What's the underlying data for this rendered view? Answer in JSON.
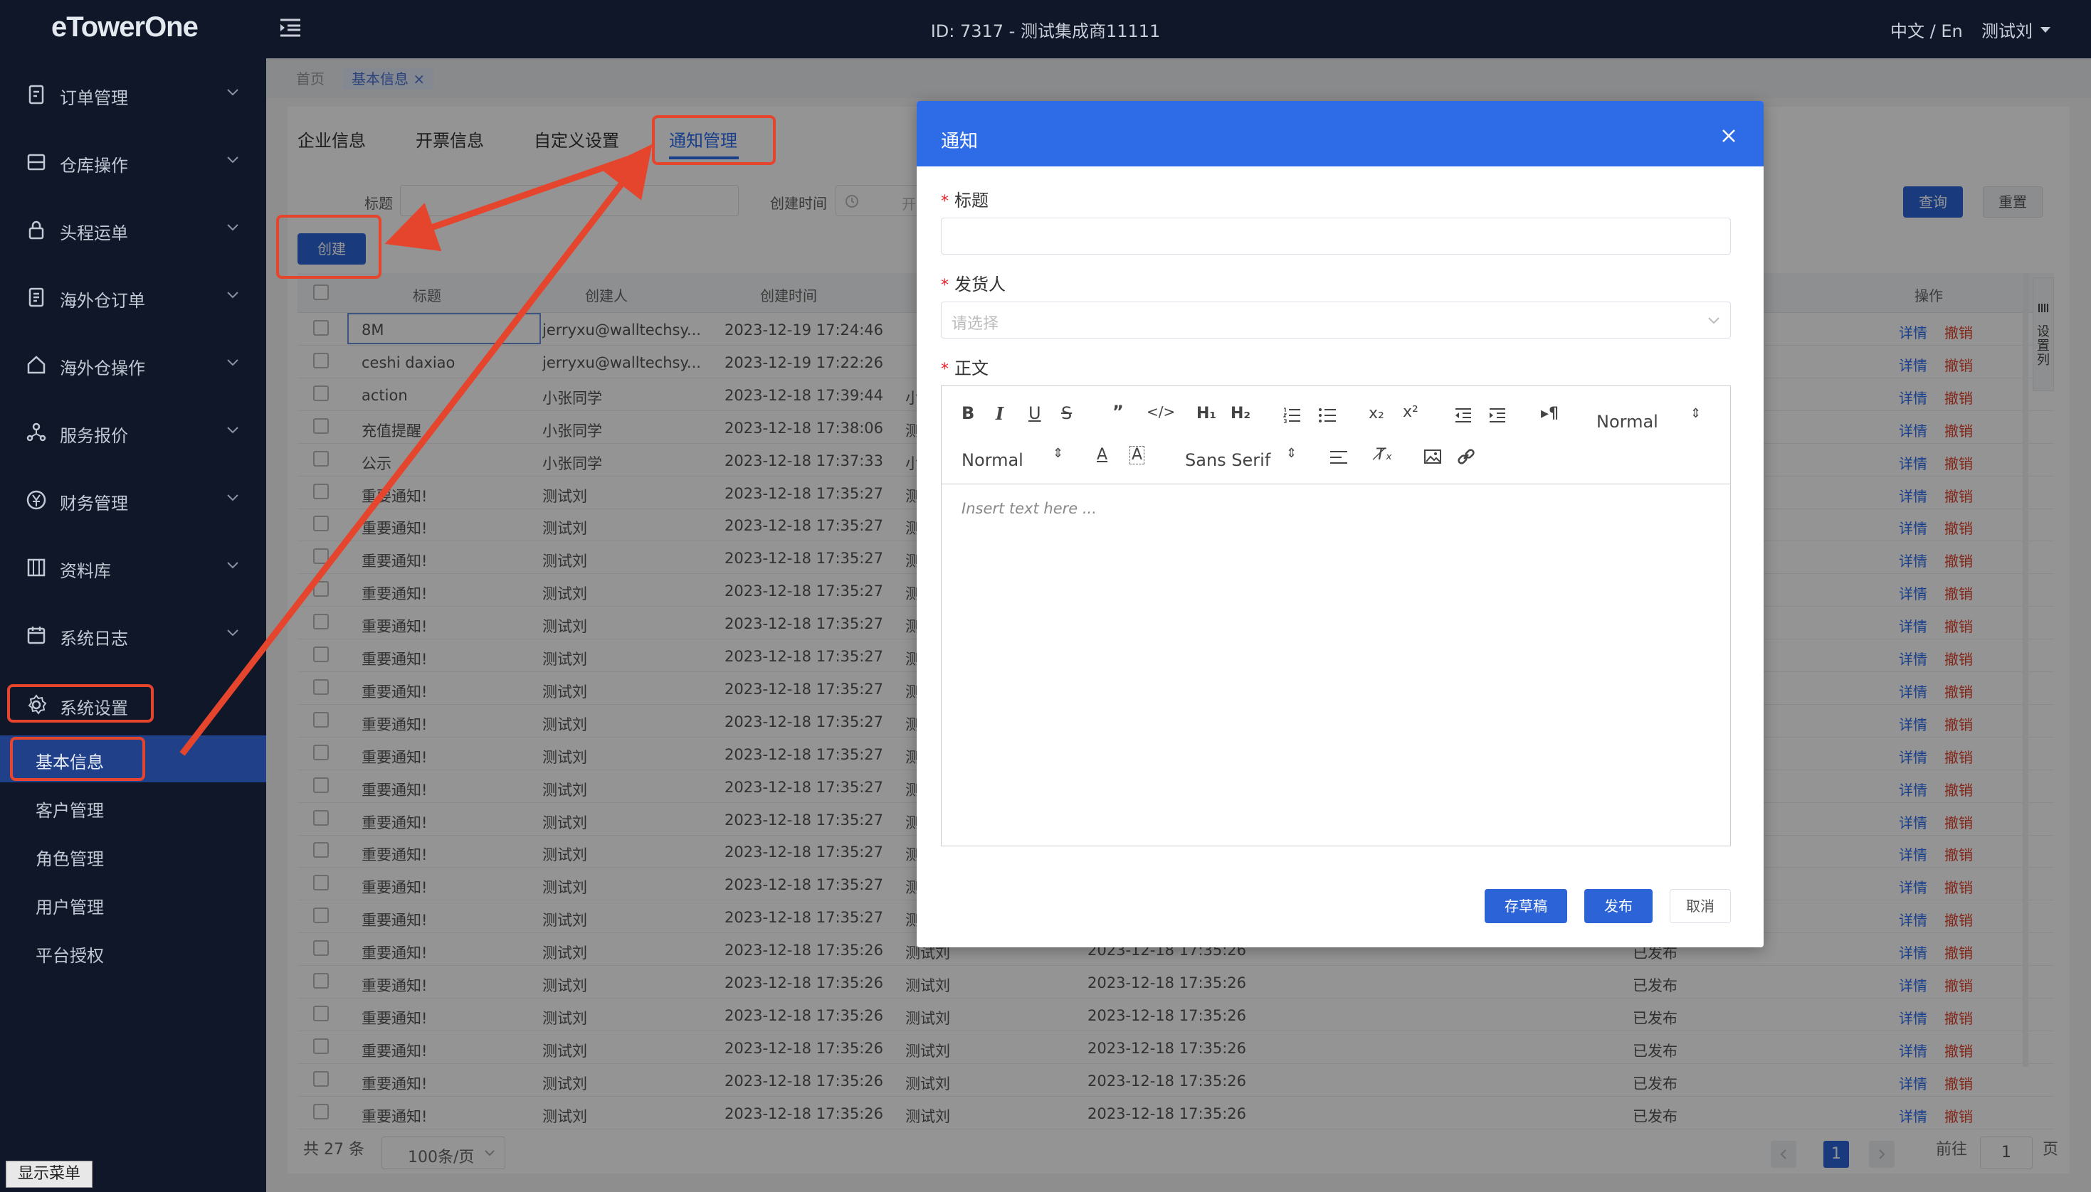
{
  "topbar": {
    "logo": "eTowerOne",
    "id_text": "ID: 7317 - 测试集成商11111",
    "lang": "中文 / En",
    "user": "测试刘"
  },
  "sidebar": {
    "items": [
      {
        "label": "订单管理",
        "icon": "order-icon"
      },
      {
        "label": "仓库操作",
        "icon": "warehouse-icon"
      },
      {
        "label": "头程运单",
        "icon": "lock-icon"
      },
      {
        "label": "海外仓订单",
        "icon": "doc-icon"
      },
      {
        "label": "海外仓操作",
        "icon": "home-icon"
      },
      {
        "label": "服务报价",
        "icon": "network-icon"
      },
      {
        "label": "财务管理",
        "icon": "yen-icon"
      },
      {
        "label": "资料库",
        "icon": "database-icon"
      },
      {
        "label": "系统日志",
        "icon": "calendar-icon"
      },
      {
        "label": "系统设置",
        "icon": "gear-icon"
      }
    ],
    "sub_items": [
      "基本信息",
      "客户管理",
      "角色管理",
      "用户管理",
      "平台授权"
    ],
    "show_menu": "显示菜单"
  },
  "breadcrumb": {
    "home": "首页",
    "current": "基本信息"
  },
  "tabs": [
    "企业信息",
    "开票信息",
    "自定义设置",
    "通知管理"
  ],
  "filters": {
    "title_label": "标题",
    "created_label": "创建时间",
    "date_placeholder": "开",
    "query": "查询",
    "reset": "重置",
    "create": "创建"
  },
  "table": {
    "headers": [
      "标题",
      "创建人",
      "创建时间",
      "操作"
    ],
    "settings_col": "设置列",
    "rows": [
      {
        "title": "8M",
        "creator": "jerryxu@walltechsy...",
        "time": "2023-12-19 17:24:46",
        "c4": "",
        "time2": "",
        "status": ""
      },
      {
        "title": "ceshi daxiao",
        "creator": "jerryxu@walltechsy...",
        "time": "2023-12-19 17:22:26",
        "c4": "",
        "time2": "",
        "status": ""
      },
      {
        "title": "action",
        "creator": "小张同学",
        "time": "2023-12-18 17:39:44",
        "c4": "小",
        "time2": "",
        "status": ""
      },
      {
        "title": "充值提醒",
        "creator": "小张同学",
        "time": "2023-12-18 17:38:06",
        "c4": "测",
        "time2": "",
        "status": ""
      },
      {
        "title": "公示",
        "creator": "小张同学",
        "time": "2023-12-18 17:37:33",
        "c4": "小",
        "time2": "",
        "status": ""
      },
      {
        "title": "重要通知!",
        "creator": "测试刘",
        "time": "2023-12-18 17:35:27",
        "c4": "测",
        "time2": "",
        "status": ""
      },
      {
        "title": "重要通知!",
        "creator": "测试刘",
        "time": "2023-12-18 17:35:27",
        "c4": "测",
        "time2": "",
        "status": ""
      },
      {
        "title": "重要通知!",
        "creator": "测试刘",
        "time": "2023-12-18 17:35:27",
        "c4": "测",
        "time2": "",
        "status": ""
      },
      {
        "title": "重要通知!",
        "creator": "测试刘",
        "time": "2023-12-18 17:35:27",
        "c4": "测",
        "time2": "",
        "status": ""
      },
      {
        "title": "重要通知!",
        "creator": "测试刘",
        "time": "2023-12-18 17:35:27",
        "c4": "测",
        "time2": "",
        "status": ""
      },
      {
        "title": "重要通知!",
        "creator": "测试刘",
        "time": "2023-12-18 17:35:27",
        "c4": "测",
        "time2": "",
        "status": ""
      },
      {
        "title": "重要通知!",
        "creator": "测试刘",
        "time": "2023-12-18 17:35:27",
        "c4": "测",
        "time2": "",
        "status": ""
      },
      {
        "title": "重要通知!",
        "creator": "测试刘",
        "time": "2023-12-18 17:35:27",
        "c4": "测",
        "time2": "",
        "status": ""
      },
      {
        "title": "重要通知!",
        "creator": "测试刘",
        "time": "2023-12-18 17:35:27",
        "c4": "测",
        "time2": "",
        "status": ""
      },
      {
        "title": "重要通知!",
        "creator": "测试刘",
        "time": "2023-12-18 17:35:27",
        "c4": "测",
        "time2": "",
        "status": ""
      },
      {
        "title": "重要通知!",
        "creator": "测试刘",
        "time": "2023-12-18 17:35:27",
        "c4": "测",
        "time2": "",
        "status": ""
      },
      {
        "title": "重要通知!",
        "creator": "测试刘",
        "time": "2023-12-18 17:35:27",
        "c4": "测",
        "time2": "",
        "status": ""
      },
      {
        "title": "重要通知!",
        "creator": "测试刘",
        "time": "2023-12-18 17:35:27",
        "c4": "测",
        "time2": "",
        "status": ""
      },
      {
        "title": "重要通知!",
        "creator": "测试刘",
        "time": "2023-12-18 17:35:27",
        "c4": "测",
        "time2": "",
        "status": ""
      },
      {
        "title": "重要通知!",
        "creator": "测试刘",
        "time": "2023-12-18 17:35:26",
        "c4": "测试刘",
        "time2": "2023-12-18 17:35:26",
        "status": "已发布"
      },
      {
        "title": "重要通知!",
        "creator": "测试刘",
        "time": "2023-12-18 17:35:26",
        "c4": "测试刘",
        "time2": "2023-12-18 17:35:26",
        "status": "已发布"
      },
      {
        "title": "重要通知!",
        "creator": "测试刘",
        "time": "2023-12-18 17:35:26",
        "c4": "测试刘",
        "time2": "2023-12-18 17:35:26",
        "status": "已发布"
      },
      {
        "title": "重要通知!",
        "creator": "测试刘",
        "time": "2023-12-18 17:35:26",
        "c4": "测试刘",
        "time2": "2023-12-18 17:35:26",
        "status": "已发布"
      },
      {
        "title": "重要通知!",
        "creator": "测试刘",
        "time": "2023-12-18 17:35:26",
        "c4": "测试刘",
        "time2": "2023-12-18 17:35:26",
        "status": "已发布"
      },
      {
        "title": "重要通知!",
        "creator": "测试刘",
        "time": "2023-12-18 17:35:26",
        "c4": "测试刘",
        "time2": "2023-12-18 17:35:26",
        "status": "已发布"
      }
    ],
    "action_detail": "详情",
    "action_revoke": "撤销"
  },
  "pagination": {
    "total": "共 27 条",
    "page_size": "100条/页",
    "current": "1",
    "goto_label": "前往",
    "goto_value": "1",
    "page_suffix": "页"
  },
  "modal": {
    "title": "通知",
    "title_label": "标题",
    "sender_label": "发货人",
    "sender_placeholder": "请选择",
    "body_label": "正文",
    "editor_placeholder": "Insert text here ...",
    "toolbar": {
      "size1": "Normal",
      "size2": "Normal",
      "font": "Sans Serif"
    },
    "save_draft": "存草稿",
    "publish": "发布",
    "cancel": "取消"
  },
  "colors": {
    "accent": "#2e6be6",
    "sidebar": "#0f1729",
    "annotation": "#e5452d",
    "danger": "#e0412b"
  }
}
